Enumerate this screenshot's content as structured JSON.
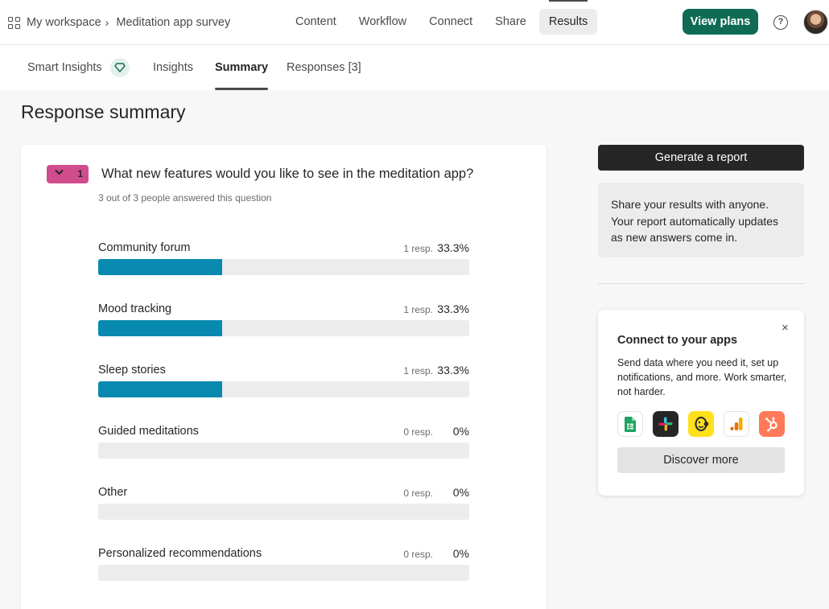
{
  "header": {
    "workspace": "My workspace",
    "separator": "›",
    "form_name": "Meditation app survey",
    "nav": [
      "Content",
      "Workflow",
      "Connect",
      "Share",
      "Results"
    ],
    "active_nav": "Results",
    "plans_button": "View plans",
    "help_icon": "?"
  },
  "subtabs": {
    "smart_insights": "Smart Insights",
    "insights": "Insights",
    "summary": "Summary",
    "responses": "Responses [3]",
    "active": "Summary"
  },
  "page_title": "Response summary",
  "question": {
    "number": "1",
    "collapse_icon": "chevron-down-icon",
    "title": "What new features would you like to see in the meditation app?",
    "answered": "3 out of 3 people answered this question",
    "options": [
      {
        "label": "Community forum",
        "resp": "1 resp.",
        "pct": "33.3%",
        "value": 33.3
      },
      {
        "label": "Mood tracking",
        "resp": "1 resp.",
        "pct": "33.3%",
        "value": 33.3
      },
      {
        "label": "Sleep stories",
        "resp": "1 resp.",
        "pct": "33.3%",
        "value": 33.3
      },
      {
        "label": "Guided meditations",
        "resp": "0 resp.",
        "pct": "0%",
        "value": 0
      },
      {
        "label": "Other",
        "resp": "0 resp.",
        "pct": "0%",
        "value": 0
      },
      {
        "label": "Personalized recommendations",
        "resp": "0 resp.",
        "pct": "0%",
        "value": 0
      }
    ]
  },
  "report": {
    "button": "Generate a report",
    "share_text": "Share your results with anyone. Your report automatically updates as new answers come in."
  },
  "connect": {
    "title": "Connect to your apps",
    "description": "Send data where you need it, set up notifications, and more. Work smarter, not harder.",
    "close_icon": "×",
    "apps": [
      "google-sheets-icon",
      "slack-icon",
      "mailchimp-icon",
      "google-analytics-icon",
      "hubspot-icon"
    ],
    "discover_button": "Discover more"
  },
  "colors": {
    "bar_fill": "#0789b0",
    "bar_track": "#ececec",
    "brand_green": "#0f6b54",
    "question_badge": "#cf4d8c"
  }
}
